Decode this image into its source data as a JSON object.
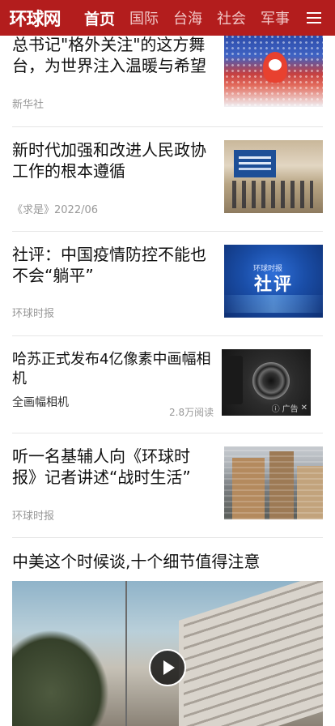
{
  "header": {
    "logo": "环球网",
    "tabs": [
      {
        "label": "首页",
        "active": true
      },
      {
        "label": "国际"
      },
      {
        "label": "台海"
      },
      {
        "label": "社会"
      },
      {
        "label": "军事"
      }
    ],
    "menu_icon": "hamburger-menu-icon",
    "brand_color": "#b31d1d"
  },
  "articles": [
    {
      "title": "总书记\"格外关注\"的这方舞台，为世界注入温暖与希望",
      "source": "新华社"
    },
    {
      "title": "新时代加强和改进人民政协工作的根本遵循",
      "source": "《求是》2022/06"
    },
    {
      "title": "社评：中国疫情防控不能也不会“躺平”",
      "source": "环球时报",
      "thumb_label": "社评",
      "thumb_badge": "环球时报"
    },
    {
      "title": "哈苏正式发布4亿像素中画幅相机",
      "subtitle": "全画幅相机",
      "reads": "2.8万阅读",
      "ad_label": "广告",
      "is_ad": true
    },
    {
      "title": "听一名基辅人向《环球时报》记者讲述“战时生活”",
      "source": "环球时报"
    },
    {
      "title": "中美这个时候谈,十个细节值得注意",
      "has_video": true
    }
  ]
}
